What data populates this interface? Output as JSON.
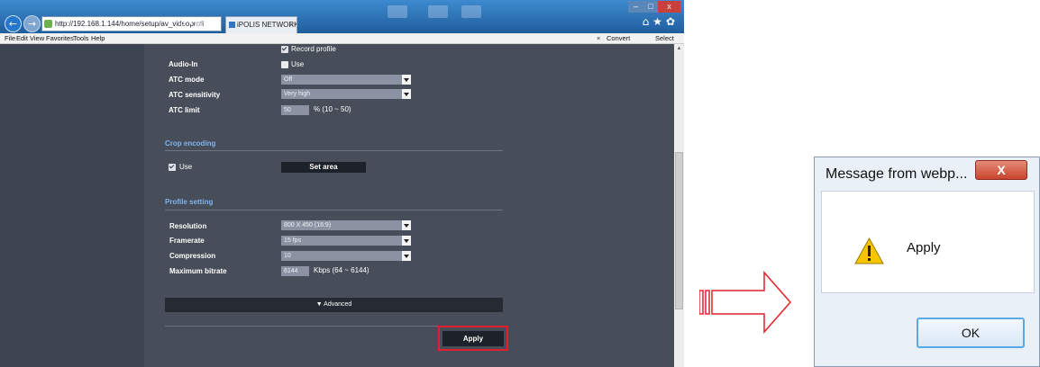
{
  "browser": {
    "address": "http://192.168.1.144/home/setup/av_videoprofi",
    "address_controls": "ρ ▾ ▤ C ×",
    "tab_title": "iPOLIS NETWORK CAMERA...",
    "tab_close": "×",
    "nav_back": "←",
    "nav_forward": "→",
    "window_min": "–",
    "window_max": "□",
    "window_close": "x",
    "toolbar_icons": "⌂★✿"
  },
  "menu": {
    "items": [
      "File",
      "Edit",
      "View",
      "Favorites",
      "Tools",
      "Help"
    ],
    "x": "×",
    "convert": "Convert",
    "select": "Select"
  },
  "form": {
    "record_profile": "Record profile",
    "audio_in_label": "Audio-In",
    "audio_in_use": "Use",
    "atc_mode_label": "ATC mode",
    "atc_mode_value": "Off",
    "atc_sensitivity_label": "ATC sensitivity",
    "atc_sensitivity_value": "Very high",
    "atc_limit_label": "ATC limit",
    "atc_limit_value": "50",
    "atc_limit_hint": "% (10 ~ 50)",
    "crop_title": "Crop encoding",
    "crop_use": "Use",
    "set_area": "Set area",
    "profile_title": "Profile setting",
    "resolution_label": "Resolution",
    "resolution_value": "800 X 450 (16:9)",
    "framerate_label": "Framerate",
    "framerate_value": "15 fps",
    "compression_label": "Compression",
    "compression_value": "10",
    "bitrate_label": "Maximum bitrate",
    "bitrate_value": "6144",
    "bitrate_hint": "Kbps (64 ~ 6144)",
    "advanced": "▼  Advanced",
    "apply": "Apply"
  },
  "dialog": {
    "title": "Message from webp...",
    "close": "X",
    "message": "Apply",
    "ok": "OK"
  },
  "colors": {
    "highlight": "#e3202a",
    "panel": "#474d59",
    "section_title": "#7fb5ec"
  }
}
